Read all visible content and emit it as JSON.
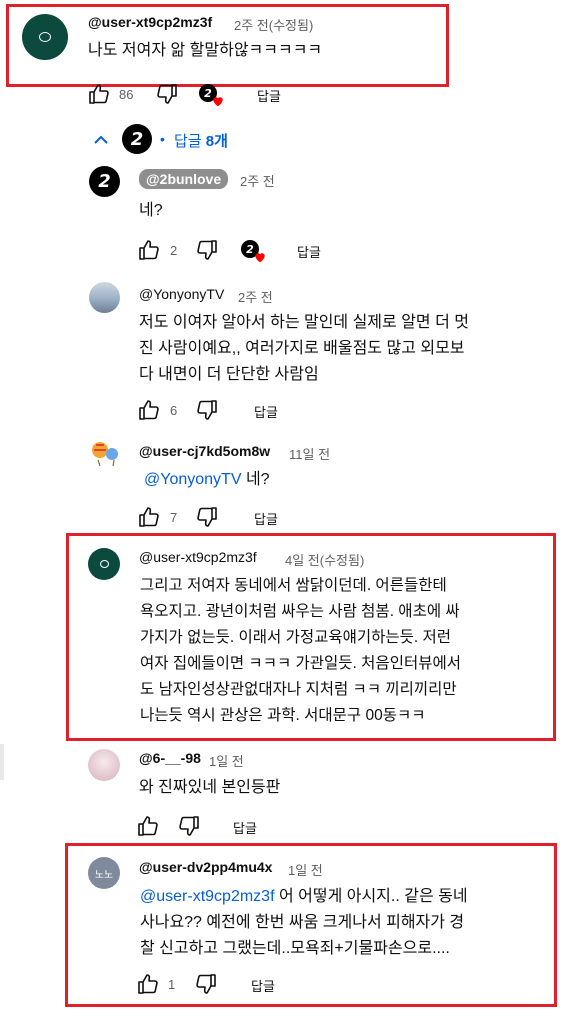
{
  "comments": [
    {
      "author": "@user-xt9cp2mz3f",
      "time": "2주 전(수정됨)",
      "text": "나도 저여자 앎 할말하않ㅋㅋㅋㅋㅋ"
    },
    {
      "author": "@2bunlove",
      "time": "2주 전",
      "text": "네?"
    },
    {
      "author": "@YonyonyTV",
      "time": "2주 전",
      "text": "저도 이여자 알아서 하는 말인데 실제로 알면 더 멋\n진 사람이예요,, 여러가지로 배울점도 많고 외모보\n다 내면이 더 단단한 사람임"
    },
    {
      "author": "@user-cj7kd5om8w",
      "time": "11일 전",
      "mention": "@YonyonyTV",
      "text": "네?"
    },
    {
      "author": "@user-xt9cp2mz3f",
      "time": "4일 전(수정됨)",
      "text": "그리고 저여자 동네에서 쌈닭이던데. 어른들한테\n욕오지고. 광년이처럼 싸우는 사람 첨봄. 애초에 싸\n가지가 없는듯. 이래서 가정교육얘기하는듯. 저런\n여자 집에들이면 ㅋㅋㅋ 가관일듯. 처음인터뷰에서\n도 남자인성상관없대자나 지처럼 ㅋㅋ 끼리끼리만\n나는듯 역시 관상은 과학. 서대문구 00동ㅋㅋ"
    },
    {
      "author": "@6-__-98",
      "time": "1일 전",
      "text": "와 진짜있네 본인등판"
    },
    {
      "author": "@user-dv2pp4mu4x",
      "time": "1일 전",
      "mention": "@user-xt9cp2mz3f",
      "text_first": " 어 어떻게 아시지.. 같은 동네",
      "text_rest": "사나요?? 예전에 한번 싸움 크게나서 피해자가 경\n찰 신고하고 그랬는데..모욕죄+기물파손으로...."
    }
  ],
  "likes": {
    "c0": "86",
    "c1": "2",
    "c2": "6",
    "c3": "7",
    "c6": "1"
  },
  "reply_label": "답글",
  "replies_toggle": {
    "prefix": "답글 ",
    "count": "8개"
  },
  "avatars": {
    "creator": "2",
    "nono": "노노"
  },
  "colors": {
    "highlight": "#e0202a",
    "link": "#065fd4",
    "heart": "#ff0000"
  }
}
